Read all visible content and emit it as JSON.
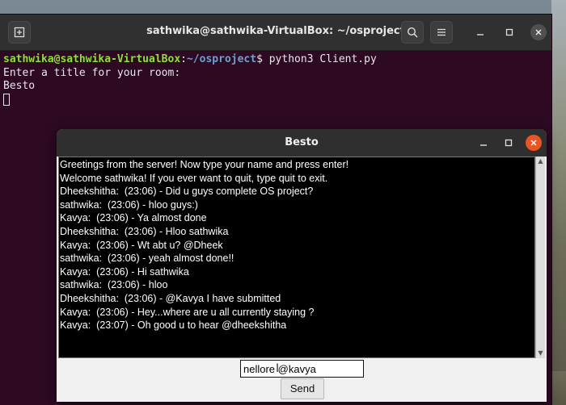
{
  "terminal": {
    "title": "sathwika@sathwika-VirtualBox: ~/osproject",
    "prompt_user": "sathwika@sathwika-VirtualBox",
    "prompt_sep": ":",
    "prompt_path": "~/osproject",
    "prompt_end": "$ ",
    "command": "python3 Client.py",
    "output": [
      "Enter a title for your room:",
      "Besto"
    ]
  },
  "chat": {
    "title": "Besto",
    "messages": [
      "Greetings from the server! Now type your name and press enter!",
      "Welcome sathwika! If you ever want to quit, type quit to exit.",
      "Dheekshitha:  (23:06) - Did u guys complete OS project?",
      "sathwika:  (23:06) - hloo guys:)",
      "Kavya:  (23:06) - Ya almost done",
      "Dheekshitha:  (23:06) - Hloo sathwika",
      "Kavya:  (23:06) - Wt abt u? @Dheek",
      "sathwika:  (23:06) - yeah almost done!!",
      "Kavya:  (23:06) - Hi sathwika",
      "sathwika:  (23:06) - hloo",
      "Dheekshitha:  (23:06) - @Kavya I have submitted",
      "Kavya:  (23:06) - Hey...where are u all currently staying ?",
      "Kavya:  (23:07) - Oh good u to hear @dheekshitha"
    ],
    "input_value": "nellore @kavya",
    "send_label": "Send"
  },
  "colors": {
    "terminal_bg": "#2d0922",
    "prompt_user": "#8ae234",
    "prompt_path": "#729fcf",
    "close_accent": "#e95420"
  }
}
